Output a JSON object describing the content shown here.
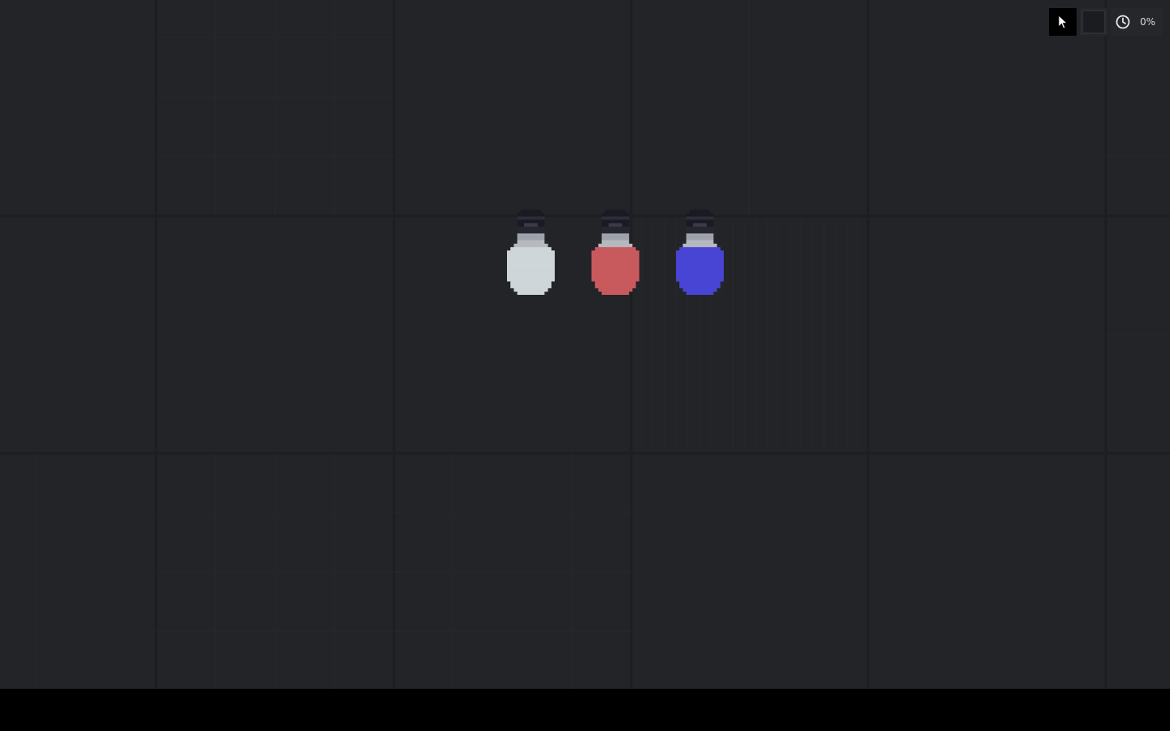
{
  "toolbar": {
    "pointer_icon": "cursor-arrow-icon",
    "swatch_icon": "color-swatch-icon",
    "time_icon": "clock-icon",
    "time_scale": "0%"
  },
  "colors": {
    "background": "#232428",
    "grid_line": "#1c1d21",
    "bottom_bar": "#000000",
    "socket": "#1a1a22",
    "neck": "#9ea3ab"
  },
  "bulbs": [
    {
      "name": "white-light-bulb",
      "color": "#cfd6da"
    },
    {
      "name": "red-light-bulb",
      "color": "#c85a5e"
    },
    {
      "name": "blue-light-bulb",
      "color": "#4845d4"
    }
  ]
}
